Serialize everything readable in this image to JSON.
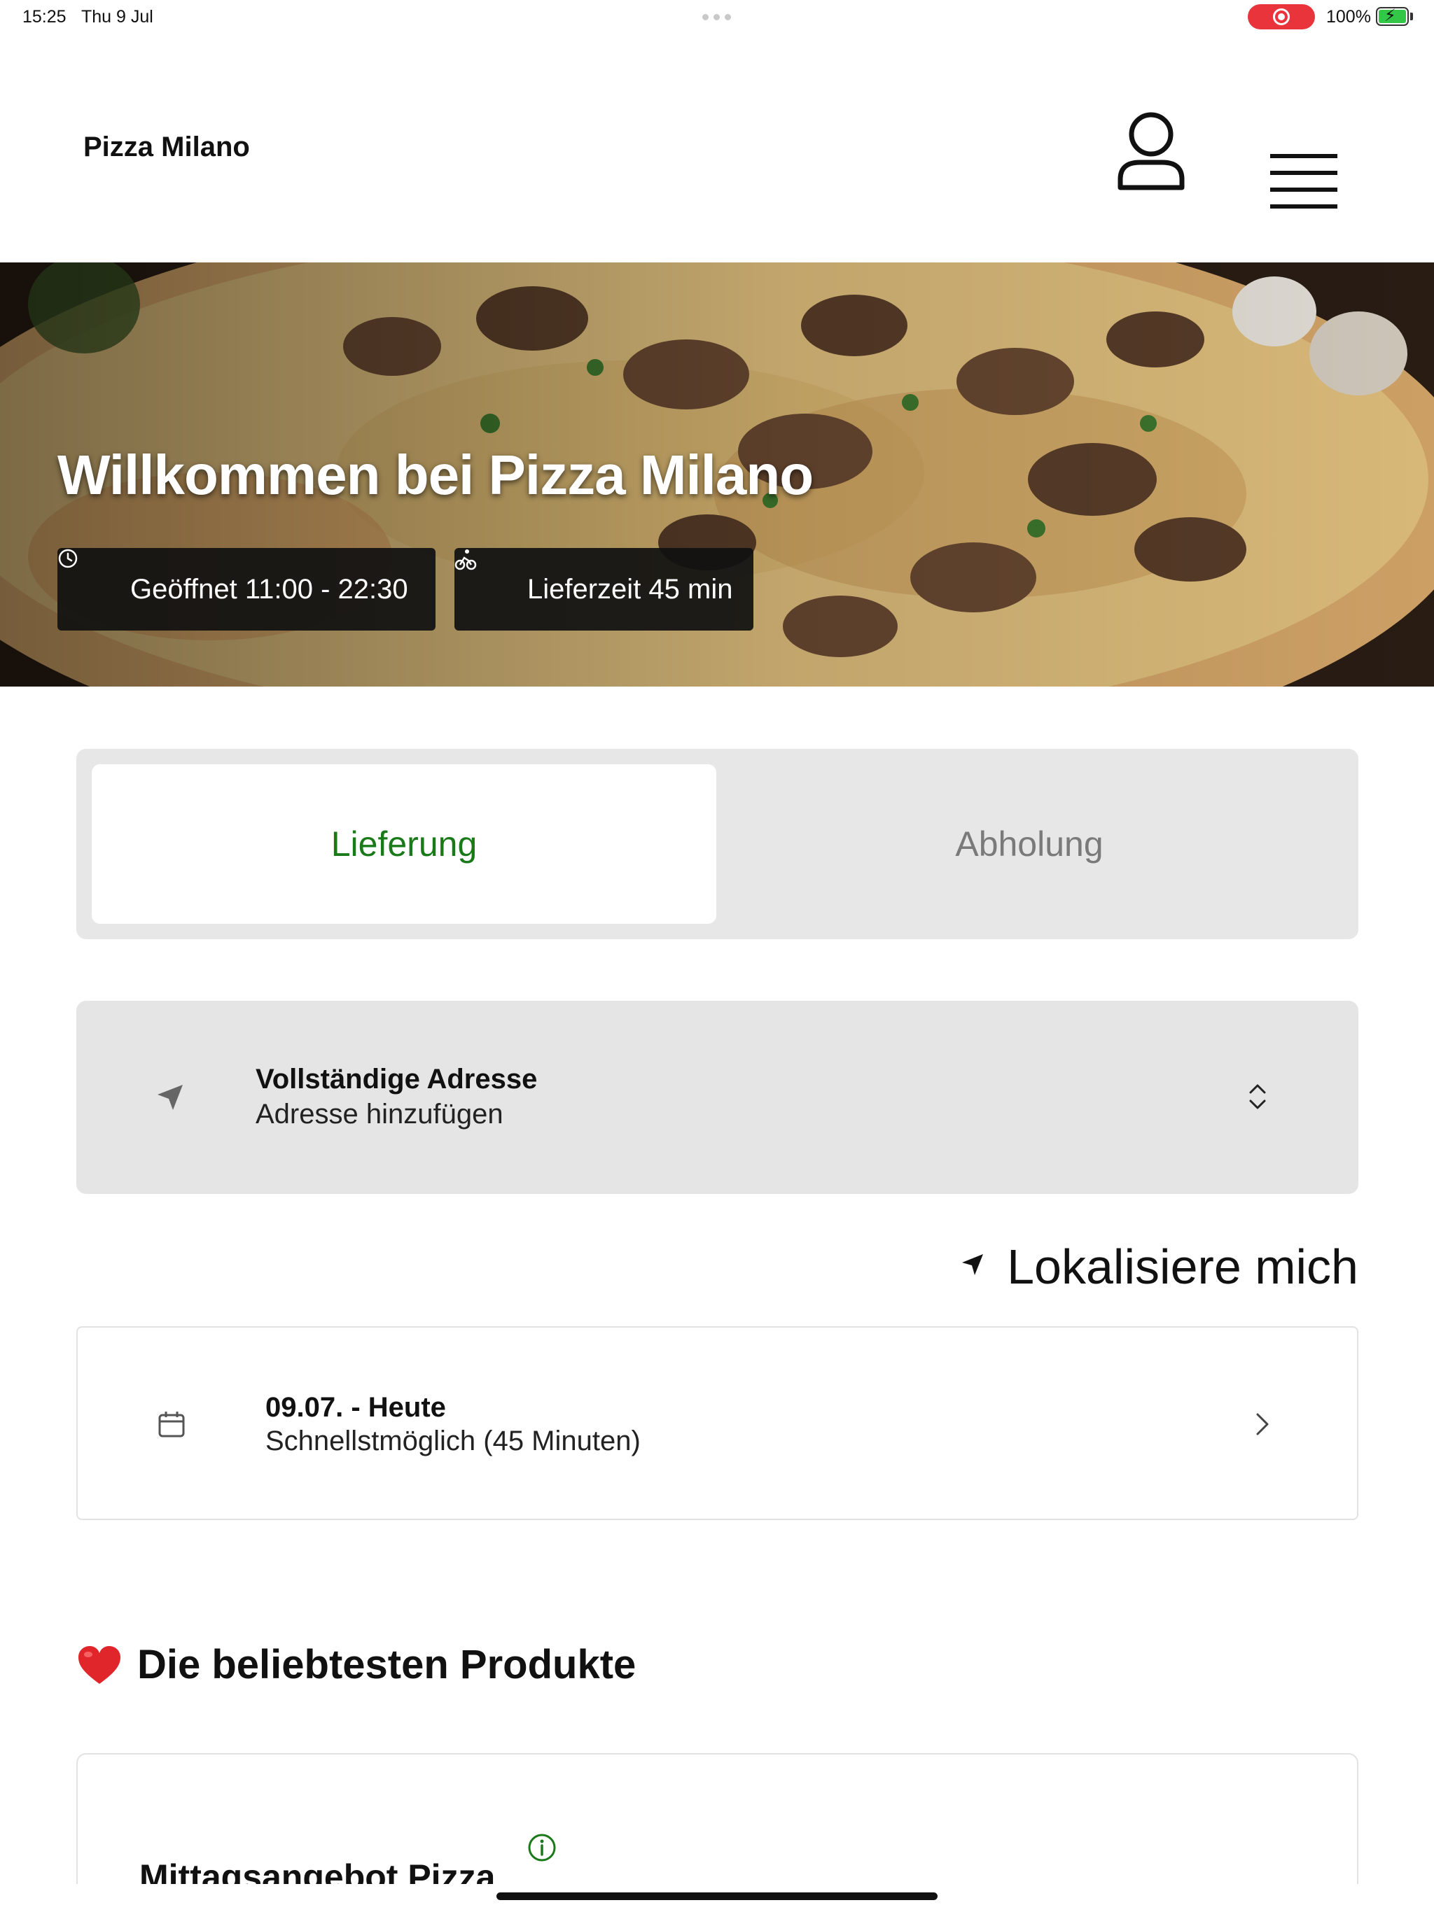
{
  "status_bar": {
    "time": "15:25",
    "date": "Thu 9 Jul",
    "battery": "100%"
  },
  "header": {
    "brand": "Pizza Milano",
    "icons": [
      "user-icon",
      "hamburger-menu-icon"
    ]
  },
  "hero": {
    "title": "Willkommen bei Pizza Milano",
    "badges": [
      {
        "icon": "clock-icon",
        "label": "Geöffnet 11:00 - 22:30"
      },
      {
        "icon": "cyclist-icon",
        "label": "Lieferzeit 45 min"
      }
    ]
  },
  "order_mode": {
    "tabs": [
      {
        "label": "Lieferung",
        "selected": true
      },
      {
        "label": "Abholung",
        "selected": false
      }
    ]
  },
  "address": {
    "title": "Vollständige Adresse",
    "placeholder": "Adresse hinzufügen",
    "icons": [
      "navigation-arrow-icon",
      "chevron-up-down-icon"
    ]
  },
  "locate": {
    "label": "Lokalisiere mich"
  },
  "delivery_time": {
    "date": "09.07. - Heute",
    "option": "Schnellstmöglich (45 Minuten)"
  },
  "popular": {
    "title": "Die beliebtesten Produkte",
    "products": [
      {
        "name": "Mittagsangebot Pizza"
      }
    ]
  },
  "colors": {
    "accent_green": "#1a7a1a",
    "segment_bg": "#e7e7e7",
    "badge_bg": "#111111",
    "record_red": "#e8343a",
    "battery_green": "#33c748"
  }
}
